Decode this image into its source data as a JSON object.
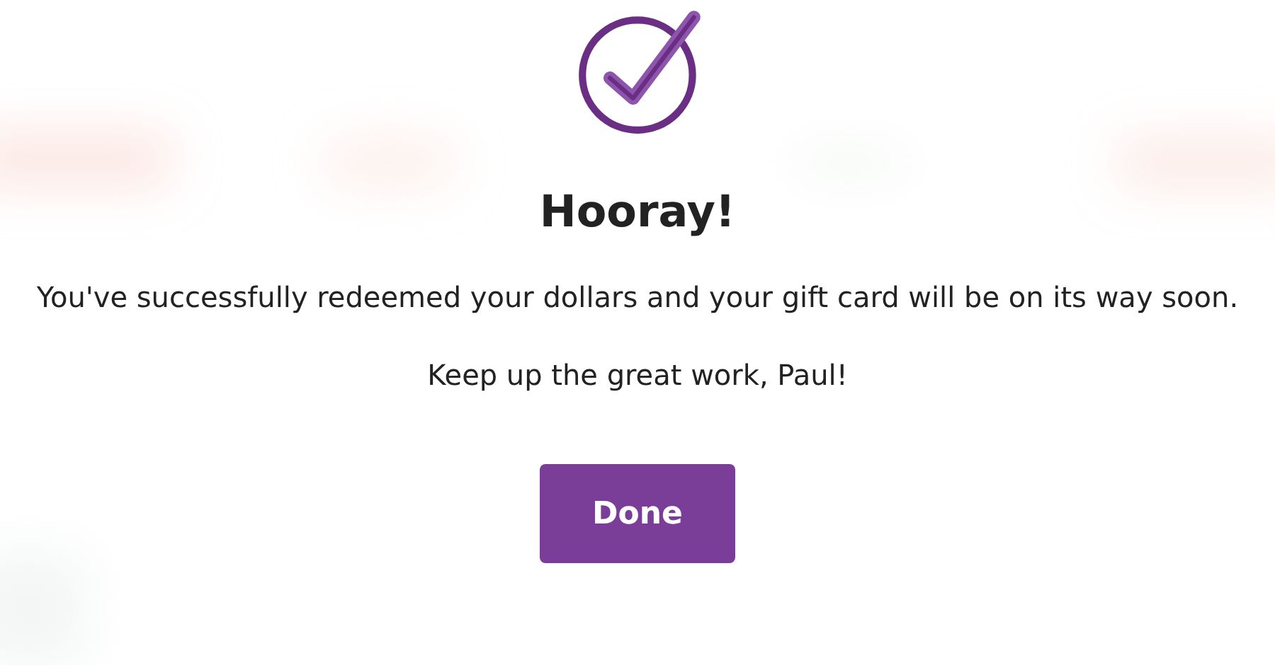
{
  "title": "Hooray!",
  "message": "You've successfully redeemed your dollars and your gift card will be on its way soon.",
  "note": "Keep up the great work, Paul!",
  "button": "Done"
}
